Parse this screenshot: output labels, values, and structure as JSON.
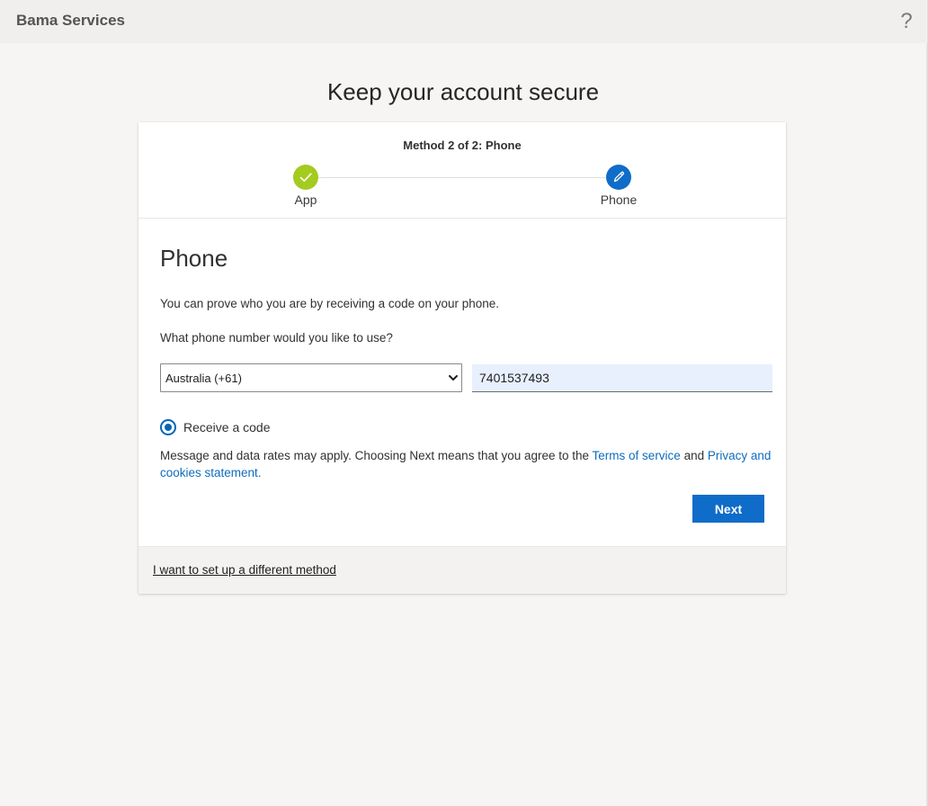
{
  "header": {
    "brand": "Bama Services",
    "help_icon": "?"
  },
  "page": {
    "title": "Keep your account secure"
  },
  "progress": {
    "method_text": "Method 2 of 2: Phone",
    "steps": [
      {
        "label": "App",
        "state": "complete",
        "icon": "checkmark-icon",
        "color": "#a4cb1f"
      },
      {
        "label": "Phone",
        "state": "current",
        "icon": "pencil-icon",
        "color": "#0f6cc9"
      }
    ]
  },
  "phone_section": {
    "title": "Phone",
    "description": "You can prove who you are by receiving a code on your phone.",
    "question": "What phone number would you like to use?",
    "country_select": {
      "selected": "Australia (+61)"
    },
    "phone_number": "7401537493",
    "radio_option": {
      "label": "Receive a code",
      "selected": true
    },
    "terms": {
      "text_before": "Message and data rates may apply. Choosing Next means that you agree to the ",
      "terms_link": "Terms of service",
      "text_middle": " and ",
      "privacy_link": "Privacy and cookies statement.",
      "link_color": "#0f6cbd"
    },
    "next_button": "Next"
  },
  "footer": {
    "different_method_link": "I want to set up a different method"
  },
  "colors": {
    "accent": "#0f6cc9",
    "success": "#a4cb1f"
  }
}
